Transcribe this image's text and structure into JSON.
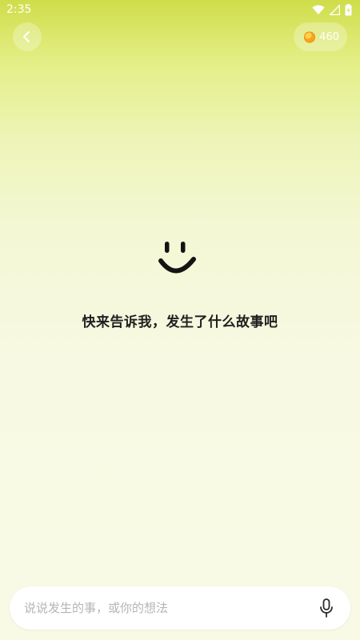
{
  "status_bar": {
    "time": "2:35",
    "icons": [
      "wifi-icon",
      "signal-icon",
      "battery-icon"
    ]
  },
  "header": {
    "back_icon": "chevron-left-icon",
    "coin_icon": "coin-icon",
    "coin_count": "460"
  },
  "main": {
    "emoji_icon": "smiley-icon",
    "prompt": "快来告诉我，发生了什么故事吧"
  },
  "composer": {
    "placeholder": "说说发生的事，或你的想法",
    "value": "",
    "mic_icon": "microphone-icon"
  },
  "colors": {
    "gradient_top": "#cfdd4a",
    "gradient_bottom": "#f8fae6",
    "coin_accent": "#f7a51c"
  }
}
